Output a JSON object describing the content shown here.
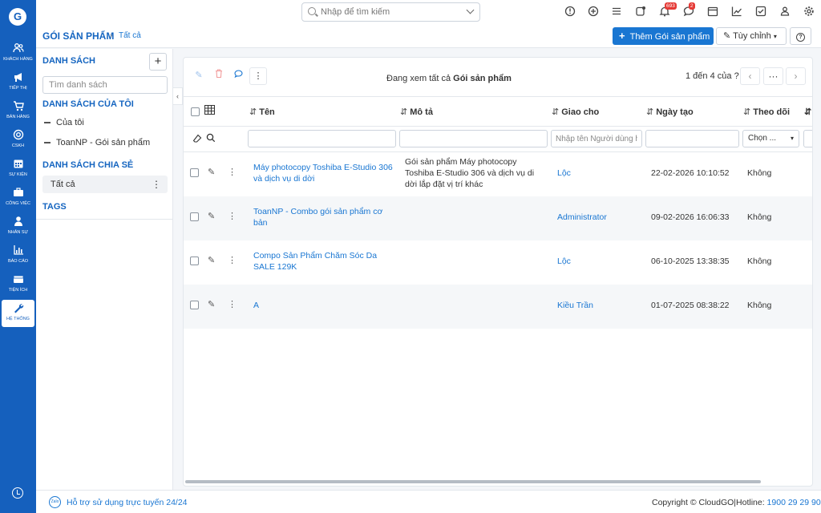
{
  "app": {
    "logo_letter": "G"
  },
  "rail": {
    "items": [
      {
        "label": "KHÁCH HÀNG",
        "icon": "users-icon"
      },
      {
        "label": "TIẾP THỊ",
        "icon": "megaphone-icon"
      },
      {
        "label": "BÁN HÀNG",
        "icon": "cart-icon"
      },
      {
        "label": "CSKH",
        "icon": "support-icon"
      },
      {
        "label": "SỰ KIỆN",
        "icon": "calendar-icon"
      },
      {
        "label": "CÔNG VIỆC",
        "icon": "briefcase-icon"
      },
      {
        "label": "NHÂN SỰ",
        "icon": "person-icon"
      },
      {
        "label": "BÁO CÁO",
        "icon": "chart-icon"
      },
      {
        "label": "TIỆN ÍCH",
        "icon": "box-icon"
      },
      {
        "label": "HỆ THỐNG",
        "icon": "wrench-icon",
        "active": true
      }
    ]
  },
  "topbar": {
    "search_placeholder": "Nhập để tìm kiếm",
    "notifications_count": "693",
    "messages_count": "2"
  },
  "breadcrumb": {
    "module": "GÓI SẢN PHẨM",
    "current": "Tất cả"
  },
  "actions": {
    "add_label": "Thêm Gói sản phẩm",
    "custom_label": "Tùy chỉnh"
  },
  "sidebar": {
    "list_header": "DANH SÁCH",
    "search_placeholder": "Tìm danh sách",
    "my_lists_header": "DANH SÁCH CỦA TÔI",
    "my_lists": [
      "Của tôi",
      "ToanNP - Gói sản phẩm"
    ],
    "shared_header": "DANH SÁCH CHIA SẺ",
    "shared_lists": [
      "Tất cả"
    ],
    "tags_header": "TAGS"
  },
  "table": {
    "viewing_prefix": "Đang xem tất cả",
    "viewing_module": "Gói sản phẩm",
    "pager": "1 đến 4 của",
    "columns": [
      "Tên",
      "Mô tả",
      "Giao cho",
      "Ngày tạo",
      "Theo dõi"
    ],
    "assignee_filter_placeholder": "Nhập tên Người dùng hoặc Nhóm",
    "follow_filter_value": "Chọn ...",
    "rows": [
      {
        "name": "Máy photocopy Toshiba E-Studio 306 và dịch vụ di dời",
        "description": "Gói sản phẩm Máy photocopy Toshiba E-Studio 306 và dịch vụ di dời lắp đặt vị trí khác",
        "assignee": "Lộc",
        "created": "22-02-2026 10:10:52",
        "follow": "Không"
      },
      {
        "name": "ToanNP - Combo gói sản phẩm cơ bản",
        "description": "",
        "assignee": "Administrator",
        "created": "09-02-2026 16:06:33",
        "follow": "Không"
      },
      {
        "name": "Compo Sản Phẩm Chăm Sóc Da SALE 129K",
        "description": "",
        "assignee": "Lộc",
        "created": "06-10-2025 13:38:35",
        "follow": "Không"
      },
      {
        "name": "A",
        "description": "",
        "assignee": "Kiều Trần",
        "created": "01-07-2025 08:38:22",
        "follow": "Không"
      }
    ]
  },
  "footer": {
    "zalo_label": "Zalo",
    "support": "Hỗ trợ sử dụng trực tuyến 24/24",
    "copyright": "Copyright © CloudGO",
    "hotline_label": "Hotline:",
    "hotline": "1900 29 29 90"
  }
}
